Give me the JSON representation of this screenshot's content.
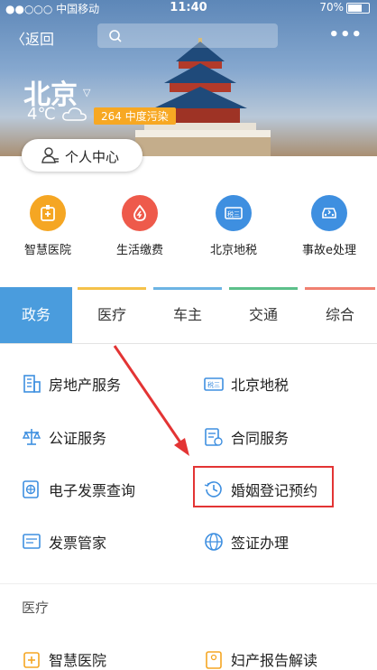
{
  "status": {
    "carrier": "●●○○○ 中国移动",
    "time": "11:40",
    "battery": "70%"
  },
  "nav": {
    "back_label": "返回",
    "more": "•••"
  },
  "hero": {
    "city": "北京",
    "temperature": "4℃",
    "air_quality": "264 中度污染",
    "personal_center": "个人中心"
  },
  "services": [
    {
      "label": "智慧医院",
      "color": "#f5a623",
      "icon": "hospital-icon"
    },
    {
      "label": "生活缴费",
      "color": "#ee5a4b",
      "icon": "utility-icon"
    },
    {
      "label": "北京地税",
      "color": "#3e8fe0",
      "icon": "tax-icon"
    },
    {
      "label": "事故e处理",
      "color": "#3e8fe0",
      "icon": "car-accident-icon"
    }
  ],
  "tabs": [
    {
      "label": "政务",
      "color": "#4a9cdd"
    },
    {
      "label": "医疗",
      "color": "#f5c24a"
    },
    {
      "label": "车主",
      "color": "#6cb4e4"
    },
    {
      "label": "交通",
      "color": "#5cc08a"
    },
    {
      "label": "综合",
      "color": "#f08070"
    }
  ],
  "gov_items": [
    {
      "label": "房地产服务",
      "icon": "building-icon"
    },
    {
      "label": "北京地税",
      "icon": "tax-icon"
    },
    {
      "label": "公证服务",
      "icon": "scale-icon"
    },
    {
      "label": "合同服务",
      "icon": "contract-icon"
    },
    {
      "label": "电子发票查询",
      "icon": "invoice-query-icon"
    },
    {
      "label": "婚姻登记预约",
      "icon": "clock-icon"
    },
    {
      "label": "发票管家",
      "icon": "invoice-icon"
    },
    {
      "label": "签证办理",
      "icon": "globe-icon"
    }
  ],
  "medical_section": {
    "title": "医疗",
    "items": [
      {
        "label": "智慧医院",
        "icon": "hospital-icon"
      },
      {
        "label": "妇产报告解读",
        "icon": "report-icon"
      }
    ]
  }
}
